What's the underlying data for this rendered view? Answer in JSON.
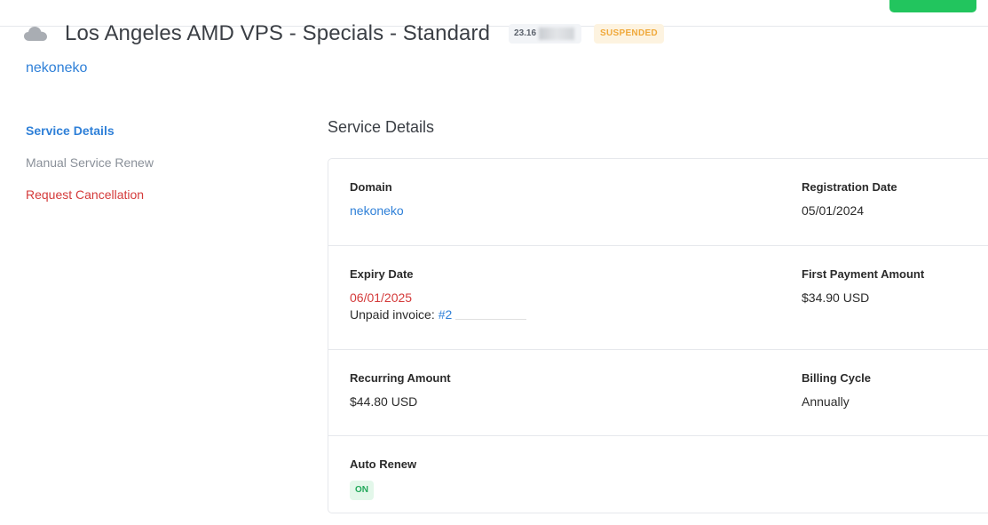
{
  "header": {
    "icon": "cloud-icon",
    "title": "Los Angeles AMD VPS - Specials - Standard",
    "ip_address": "23.16",
    "status": "SUSPENDED",
    "service_link": "nekoneko"
  },
  "sidebar": {
    "items": [
      {
        "label": "Service Details"
      },
      {
        "label": "Manual Service Renew"
      },
      {
        "label": "Request Cancellation"
      }
    ]
  },
  "main": {
    "section_title": "Service Details",
    "details": {
      "domain_label": "Domain",
      "domain_value": "nekoneko",
      "registration_label": "Registration Date",
      "registration_value": "05/01/2024",
      "expiry_label": "Expiry Date",
      "expiry_value": "06/01/2025",
      "unpaid_label": "Unpaid invoice:",
      "unpaid_link": "#2",
      "first_payment_label": "First Payment Amount",
      "first_payment_value": "$34.90 USD",
      "recurring_label": "Recurring Amount",
      "recurring_value": "$44.80 USD",
      "billing_cycle_label": "Billing Cycle",
      "billing_cycle_value": "Annually",
      "auto_renew_label": "Auto Renew",
      "auto_renew_value": "ON"
    }
  },
  "colors": {
    "accent": "#2f80d8",
    "danger": "#d43a3a",
    "suspended": "#f0a93b",
    "success": "#22c55e"
  }
}
